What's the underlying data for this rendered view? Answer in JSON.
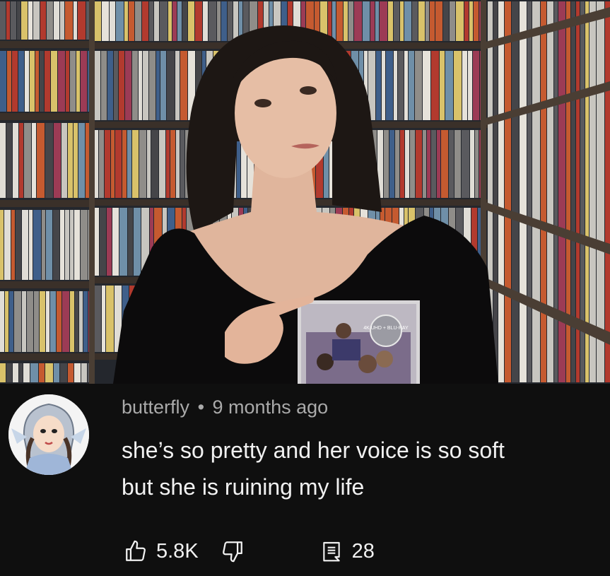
{
  "video": {
    "blu_ray_sticker": "4K UHD + BLU-RAY"
  },
  "comment": {
    "author": "butterfly",
    "separator": "•",
    "timestamp": "9 months ago",
    "text_line1": "she’s so pretty and her voice is so soft",
    "text_line2": "but she is ruining my life",
    "like_count": "5.8K",
    "reply_count": "28",
    "icons": {
      "like": "thumbs-up-icon",
      "dislike": "thumbs-down-icon",
      "replies": "comment-icon"
    }
  },
  "colors": {
    "background": "#0f0f0f",
    "primary_text": "#f1f1f1",
    "secondary_text": "#aaaaaa"
  }
}
